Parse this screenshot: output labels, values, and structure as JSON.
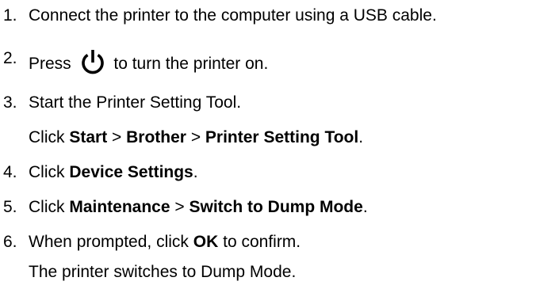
{
  "steps": [
    {
      "number": "1.",
      "text": "Connect the printer to the computer using a USB cable."
    },
    {
      "number": "2.",
      "before": "Press",
      "icon": "power-icon",
      "after": "to turn the printer on."
    },
    {
      "number": "3.",
      "text": "Start the Printer Setting Tool.",
      "sub": {
        "click": "Click",
        "start": "Start",
        "sep1": " > ",
        "brother": "Brother",
        "sep2": " > ",
        "tool": "Printer Setting Tool",
        "end": "."
      }
    },
    {
      "number": "4.",
      "click": "Click",
      "target": "Device Settings",
      "end": "."
    },
    {
      "number": "5.",
      "click": "Click",
      "menu": "Maintenance",
      "sep": " > ",
      "item": "Switch to Dump Mode",
      "end": "."
    },
    {
      "number": "6.",
      "before": "When prompted, click",
      "button": "OK",
      "after": "to confirm.",
      "result": "The printer switches to Dump Mode."
    }
  ]
}
